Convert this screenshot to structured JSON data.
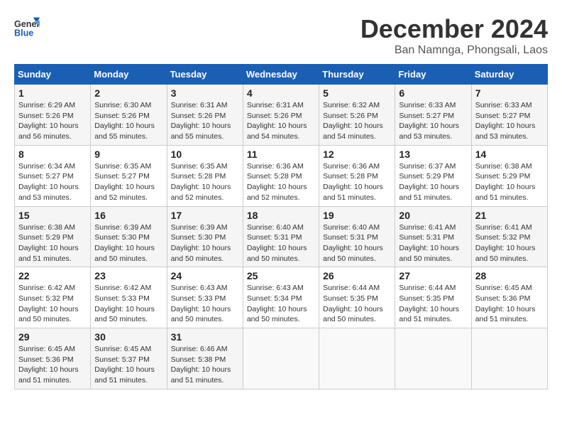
{
  "logo": {
    "line1": "General",
    "line2": "Blue"
  },
  "title": "December 2024",
  "subtitle": "Ban Namnga, Phongsali, Laos",
  "weekdays": [
    "Sunday",
    "Monday",
    "Tuesday",
    "Wednesday",
    "Thursday",
    "Friday",
    "Saturday"
  ],
  "weeks": [
    [
      {
        "day": "1",
        "sunrise": "6:29 AM",
        "sunset": "5:26 PM",
        "daylight": "10 hours and 56 minutes."
      },
      {
        "day": "2",
        "sunrise": "6:30 AM",
        "sunset": "5:26 PM",
        "daylight": "10 hours and 55 minutes."
      },
      {
        "day": "3",
        "sunrise": "6:31 AM",
        "sunset": "5:26 PM",
        "daylight": "10 hours and 55 minutes."
      },
      {
        "day": "4",
        "sunrise": "6:31 AM",
        "sunset": "5:26 PM",
        "daylight": "10 hours and 54 minutes."
      },
      {
        "day": "5",
        "sunrise": "6:32 AM",
        "sunset": "5:26 PM",
        "daylight": "10 hours and 54 minutes."
      },
      {
        "day": "6",
        "sunrise": "6:33 AM",
        "sunset": "5:27 PM",
        "daylight": "10 hours and 53 minutes."
      },
      {
        "day": "7",
        "sunrise": "6:33 AM",
        "sunset": "5:27 PM",
        "daylight": "10 hours and 53 minutes."
      }
    ],
    [
      {
        "day": "8",
        "sunrise": "6:34 AM",
        "sunset": "5:27 PM",
        "daylight": "10 hours and 53 minutes."
      },
      {
        "day": "9",
        "sunrise": "6:35 AM",
        "sunset": "5:27 PM",
        "daylight": "10 hours and 52 minutes."
      },
      {
        "day": "10",
        "sunrise": "6:35 AM",
        "sunset": "5:28 PM",
        "daylight": "10 hours and 52 minutes."
      },
      {
        "day": "11",
        "sunrise": "6:36 AM",
        "sunset": "5:28 PM",
        "daylight": "10 hours and 52 minutes."
      },
      {
        "day": "12",
        "sunrise": "6:36 AM",
        "sunset": "5:28 PM",
        "daylight": "10 hours and 51 minutes."
      },
      {
        "day": "13",
        "sunrise": "6:37 AM",
        "sunset": "5:29 PM",
        "daylight": "10 hours and 51 minutes."
      },
      {
        "day": "14",
        "sunrise": "6:38 AM",
        "sunset": "5:29 PM",
        "daylight": "10 hours and 51 minutes."
      }
    ],
    [
      {
        "day": "15",
        "sunrise": "6:38 AM",
        "sunset": "5:29 PM",
        "daylight": "10 hours and 51 minutes."
      },
      {
        "day": "16",
        "sunrise": "6:39 AM",
        "sunset": "5:30 PM",
        "daylight": "10 hours and 50 minutes."
      },
      {
        "day": "17",
        "sunrise": "6:39 AM",
        "sunset": "5:30 PM",
        "daylight": "10 hours and 50 minutes."
      },
      {
        "day": "18",
        "sunrise": "6:40 AM",
        "sunset": "5:31 PM",
        "daylight": "10 hours and 50 minutes."
      },
      {
        "day": "19",
        "sunrise": "6:40 AM",
        "sunset": "5:31 PM",
        "daylight": "10 hours and 50 minutes."
      },
      {
        "day": "20",
        "sunrise": "6:41 AM",
        "sunset": "5:31 PM",
        "daylight": "10 hours and 50 minutes."
      },
      {
        "day": "21",
        "sunrise": "6:41 AM",
        "sunset": "5:32 PM",
        "daylight": "10 hours and 50 minutes."
      }
    ],
    [
      {
        "day": "22",
        "sunrise": "6:42 AM",
        "sunset": "5:32 PM",
        "daylight": "10 hours and 50 minutes."
      },
      {
        "day": "23",
        "sunrise": "6:42 AM",
        "sunset": "5:33 PM",
        "daylight": "10 hours and 50 minutes."
      },
      {
        "day": "24",
        "sunrise": "6:43 AM",
        "sunset": "5:33 PM",
        "daylight": "10 hours and 50 minutes."
      },
      {
        "day": "25",
        "sunrise": "6:43 AM",
        "sunset": "5:34 PM",
        "daylight": "10 hours and 50 minutes."
      },
      {
        "day": "26",
        "sunrise": "6:44 AM",
        "sunset": "5:35 PM",
        "daylight": "10 hours and 50 minutes."
      },
      {
        "day": "27",
        "sunrise": "6:44 AM",
        "sunset": "5:35 PM",
        "daylight": "10 hours and 51 minutes."
      },
      {
        "day": "28",
        "sunrise": "6:45 AM",
        "sunset": "5:36 PM",
        "daylight": "10 hours and 51 minutes."
      }
    ],
    [
      {
        "day": "29",
        "sunrise": "6:45 AM",
        "sunset": "5:36 PM",
        "daylight": "10 hours and 51 minutes."
      },
      {
        "day": "30",
        "sunrise": "6:45 AM",
        "sunset": "5:37 PM",
        "daylight": "10 hours and 51 minutes."
      },
      {
        "day": "31",
        "sunrise": "6:46 AM",
        "sunset": "5:38 PM",
        "daylight": "10 hours and 51 minutes."
      },
      null,
      null,
      null,
      null
    ]
  ]
}
